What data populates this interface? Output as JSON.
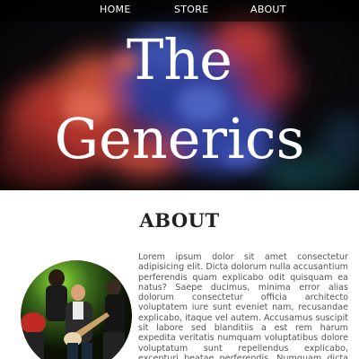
{
  "nav": {
    "items": [
      "HOME",
      "STORE",
      "ABOUT"
    ]
  },
  "hero": {
    "title_line1": "The",
    "title_line2": "Generics"
  },
  "about": {
    "heading": "ABOUT",
    "photo_alt": "band-performing-photo",
    "body": "Lorem ipsum dolor sit amet consectetur adipisicing elit. Dicta dolorum nulla accusantium perferendis quam explicabo odit quisquam ea natus? Saepe ducimus, minima error alias dolorum consectetur officia architecto voluptatem iure sunt eveniet nam, recusandae explicabo, itaque vel autem. Accusamus suscipit sit labore sed blanditiis a est rem harum expedita veritatis numquam voluptatibus dolore voluptatum sunt repellendus explicabo, excepturi beatae perferendis. Numquam dicta quis ipsum explicabo suscipit alias placeat, ea, vero minus"
  },
  "colors": {
    "nav_bg": "#000000",
    "hero_bg": "#0b0a0d",
    "smoke_red": "#c8453a",
    "smoke_blue": "#3a4fb5",
    "heading_text": "#222222",
    "body_text": "#555555"
  }
}
